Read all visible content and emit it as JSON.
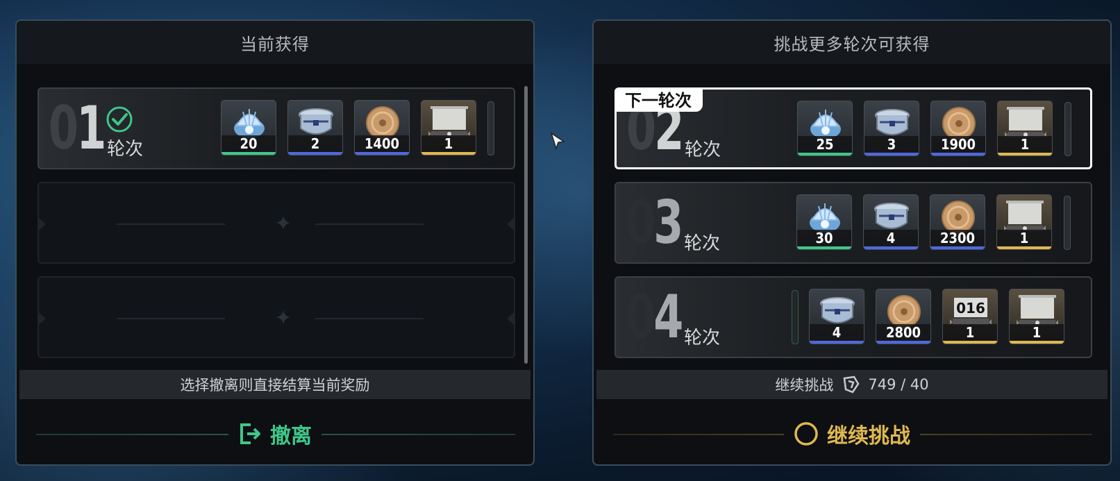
{
  "left_panel": {
    "title": "当前获得",
    "rounds": [
      {
        "num_a": "0",
        "num_b": "1",
        "label": "轮次",
        "completed": true,
        "items": [
          {
            "icon": "shell-icon",
            "qty": "20",
            "rarity": "green"
          },
          {
            "icon": "pot-icon",
            "qty": "2",
            "rarity": "blue"
          },
          {
            "icon": "coin-icon",
            "qty": "1400",
            "rarity": "blue"
          },
          {
            "icon": "scroll-icon",
            "qty": "1",
            "rarity": "gold"
          }
        ]
      }
    ],
    "info": "选择撤离则直接结算当前奖励",
    "action_label": "撤离",
    "action_color": "#3fc78a"
  },
  "right_panel": {
    "title": "挑战更多轮次可获得",
    "next_tag": "下一轮次",
    "rounds": [
      {
        "num_a": "0",
        "num_b": "2",
        "label": "轮次",
        "items": [
          {
            "icon": "shell-icon",
            "qty": "25",
            "rarity": "green"
          },
          {
            "icon": "pot-icon",
            "qty": "3",
            "rarity": "blue"
          },
          {
            "icon": "coin-icon",
            "qty": "1900",
            "rarity": "blue"
          },
          {
            "icon": "scroll-icon",
            "qty": "1",
            "rarity": "gold"
          }
        ]
      },
      {
        "num_a": "0",
        "num_b": "3",
        "label": "轮次",
        "items": [
          {
            "icon": "shell-icon",
            "qty": "30",
            "rarity": "green"
          },
          {
            "icon": "pot-icon",
            "qty": "4",
            "rarity": "blue"
          },
          {
            "icon": "coin-icon",
            "qty": "2300",
            "rarity": "blue"
          },
          {
            "icon": "scroll-icon",
            "qty": "1",
            "rarity": "gold"
          }
        ]
      },
      {
        "num_a": "0",
        "num_b": "4",
        "label": "轮次",
        "items": [
          {
            "icon": "pot-icon",
            "qty": "4",
            "rarity": "blue"
          },
          {
            "icon": "coin-icon",
            "qty": "2800",
            "rarity": "blue"
          },
          {
            "icon": "counter-scroll-icon",
            "qty": "1",
            "rarity": "gold",
            "text": "016"
          },
          {
            "icon": "scroll-icon",
            "qty": "1",
            "rarity": "gold"
          }
        ]
      }
    ],
    "info_label": "继续挑战",
    "info_icon": "stamina-icon",
    "info_value": "749 / 40",
    "action_label": "继续挑战",
    "action_color": "#e0b850"
  }
}
